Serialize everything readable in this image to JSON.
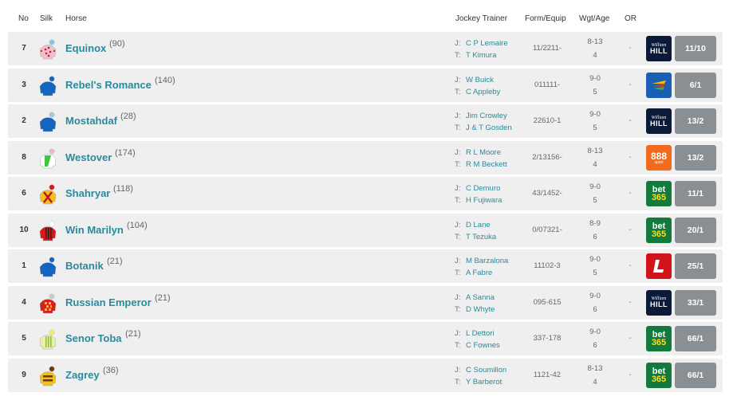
{
  "header": {
    "no": "No",
    "silk": "Silk",
    "horse": "Horse",
    "jockey_trainer": "Jockey Trainer",
    "form_equip": "Form/Equip",
    "wgt_age": "Wgt/Age",
    "or": "OR"
  },
  "labels": {
    "jockey": "J:",
    "trainer": "T:"
  },
  "runners": [
    {
      "no": "7",
      "horse": "Equinox",
      "rating": "(90)",
      "jockey": "C P Lemaire",
      "trainer": "T Kimura",
      "form": "11/2211-",
      "wgt": "8-13",
      "age": "4",
      "or": "-",
      "bookie": "william-hill",
      "odds": "11/10",
      "silk": {
        "body": "#f0c0c8",
        "pattern": "spots",
        "accent": "#c8184a",
        "cap": "#7ec7f0"
      }
    },
    {
      "no": "3",
      "horse": "Rebel's Romance",
      "rating": "(140)",
      "jockey": "W Buick",
      "trainer": "C Appleby",
      "form": "011111-",
      "wgt": "9-0",
      "age": "5",
      "or": "-",
      "bookie": "betfred",
      "odds": "6/1",
      "silk": {
        "body": "#1565c0",
        "pattern": "plain",
        "accent": "#1565c0",
        "cap": "#1565c0"
      }
    },
    {
      "no": "2",
      "horse": "Mostahdaf",
      "rating": "(28)",
      "jockey": "Jim Crowley",
      "trainer": "J & T Gosden",
      "form": "22610-1",
      "wgt": "9-0",
      "age": "5",
      "or": "-",
      "bookie": "william-hill",
      "odds": "13/2",
      "silk": {
        "body": "#1565c0",
        "pattern": "plain",
        "accent": "#1565c0",
        "cap": "#9ecbe8"
      }
    },
    {
      "no": "8",
      "horse": "Westover",
      "rating": "(174)",
      "jockey": "R L Moore",
      "trainer": "R M Beckett",
      "form": "2/13156-",
      "wgt": "8-13",
      "age": "4",
      "or": "-",
      "bookie": "888sport",
      "odds": "13/2",
      "silk": {
        "body": "#ffffff",
        "pattern": "sash",
        "accent": "#3cc83c",
        "cap": "#f0b8c8"
      }
    },
    {
      "no": "6",
      "horse": "Shahryar",
      "rating": "(118)",
      "jockey": "C Demuro",
      "trainer": "H Fujiwara",
      "form": "43/1452-",
      "wgt": "9-0",
      "age": "5",
      "or": "-",
      "bookie": "bet365",
      "odds": "11/1",
      "silk": {
        "body": "#f0c020",
        "pattern": "cross",
        "accent": "#c01818",
        "cap": "#e01818"
      }
    },
    {
      "no": "10",
      "horse": "Win Marilyn",
      "rating": "(104)",
      "jockey": "D Lane",
      "trainer": "T Tezuka",
      "form": "0/07321-",
      "wgt": "8-9",
      "age": "6",
      "or": "-",
      "bookie": "bet365",
      "odds": "20/1",
      "silk": {
        "body": "#d81818",
        "pattern": "stripes",
        "accent": "#222222",
        "cap": "#ffffff"
      }
    },
    {
      "no": "1",
      "horse": "Botanik",
      "rating": "(21)",
      "jockey": "M Barzalona",
      "trainer": "A Fabre",
      "form": "11102-3",
      "wgt": "9-0",
      "age": "5",
      "or": "-",
      "bookie": "ladbrokes",
      "odds": "25/1",
      "silk": {
        "body": "#1565c0",
        "pattern": "plain",
        "accent": "#1565c0",
        "cap": "#1565c0"
      }
    },
    {
      "no": "4",
      "horse": "Russian Emperor",
      "rating": "(21)",
      "jockey": "A Sanna",
      "trainer": "D Whyte",
      "form": "095-615",
      "wgt": "9-0",
      "age": "6",
      "or": "-",
      "bookie": "william-hill",
      "odds": "33/1",
      "silk": {
        "body": "#d82020",
        "pattern": "check",
        "accent": "#f0c020",
        "cap": "#cccccc"
      }
    },
    {
      "no": "5",
      "horse": "Senor Toba",
      "rating": "(21)",
      "jockey": "L Dettori",
      "trainer": "C Fownes",
      "form": "337-178",
      "wgt": "9-0",
      "age": "6",
      "or": "-",
      "bookie": "bet365",
      "odds": "66/1",
      "silk": {
        "body": "#e8f0a8",
        "pattern": "stripes",
        "accent": "#90c040",
        "cap": "#f0f060"
      }
    },
    {
      "no": "9",
      "horse": "Zagrey",
      "rating": "(36)",
      "jockey": "C Soumillon",
      "trainer": "Y Barberot",
      "form": "1121-42",
      "wgt": "8-13",
      "age": "4",
      "or": "-",
      "bookie": "bet365",
      "odds": "66/1",
      "silk": {
        "body": "#f0c020",
        "pattern": "hoops",
        "accent": "#6a3a10",
        "cap": "#6a3a10"
      }
    }
  ],
  "bookies": {
    "william-hill": {
      "line1": "William",
      "line2": "HILL",
      "bg": "#0c1a3a",
      "fg": "#ffffff"
    },
    "betfred": {
      "bg": "#1a5fb4"
    },
    "888sport": {
      "line1": "888",
      "line2": "sport",
      "bg": "#f26b1d",
      "fg": "#ffffff"
    },
    "bet365": {
      "line1": "bet",
      "line2": "365",
      "bg": "#127a3c",
      "fg": "#ffffff",
      "accent": "#ffdf1b"
    },
    "ladbrokes": {
      "bg": "#d0141a",
      "fg": "#ffffff"
    }
  }
}
